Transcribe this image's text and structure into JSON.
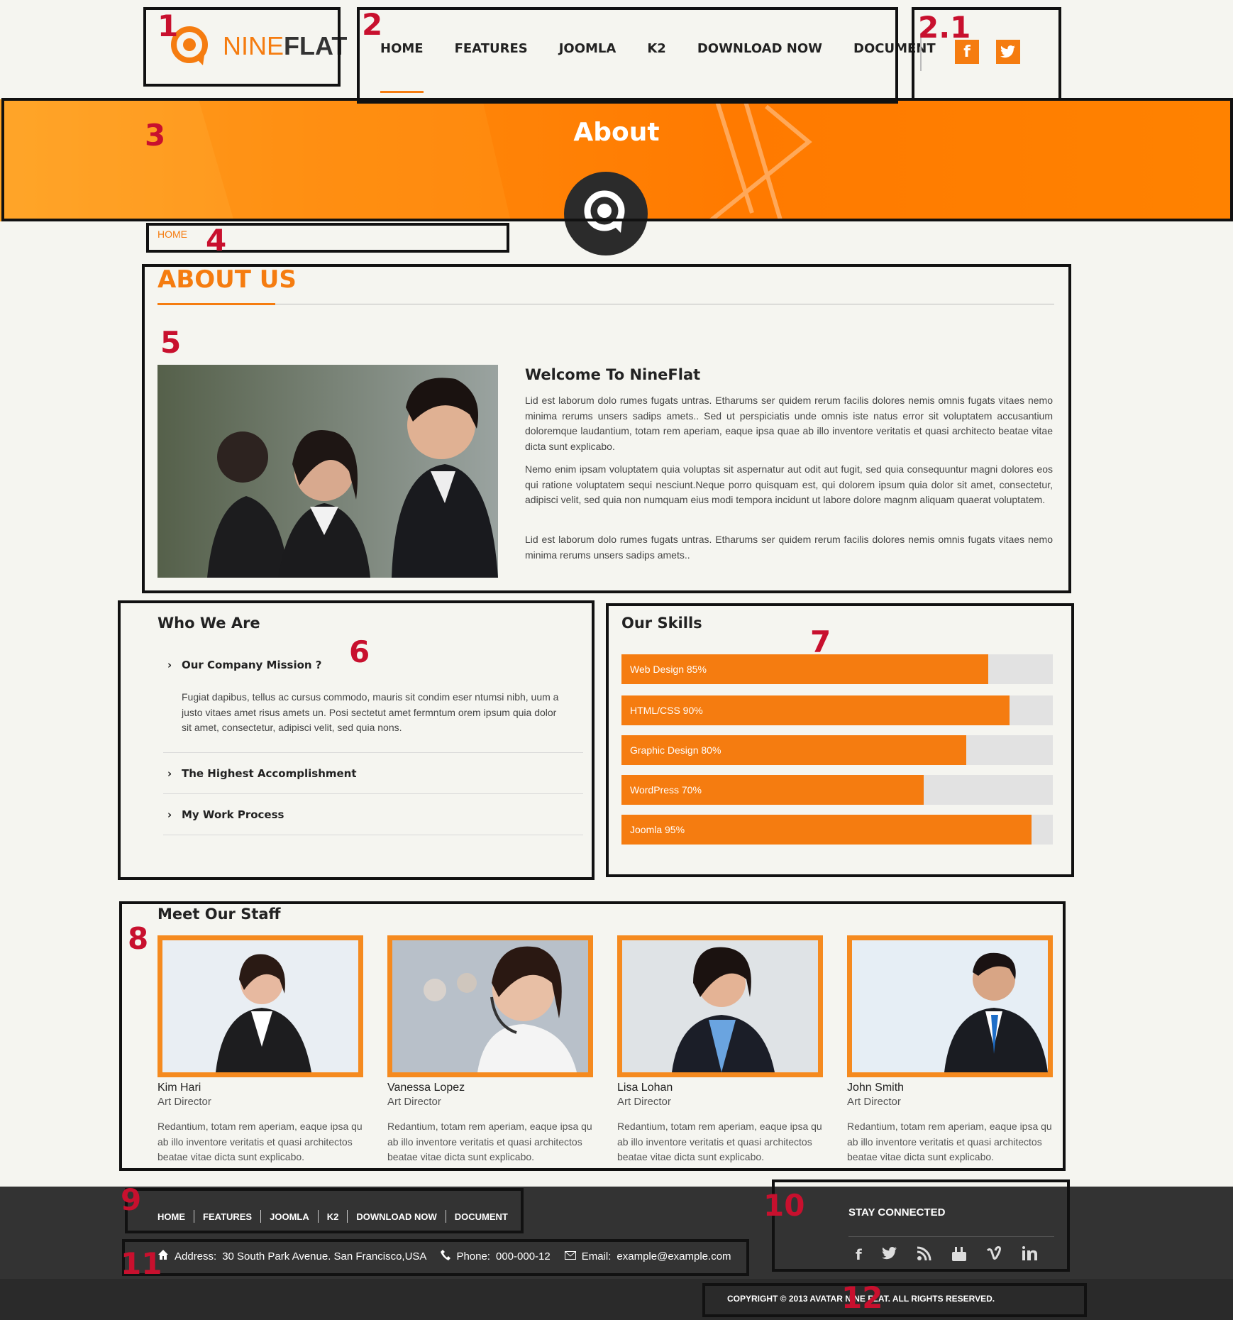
{
  "header": {
    "logo_nine": "NINE",
    "logo_flat": "FLAT",
    "nav": [
      "HOME",
      "FEATURES",
      "JOOMLA",
      "K2",
      "DOWNLOAD NOW",
      "DOCUMENT"
    ],
    "social": [
      "f",
      "t"
    ]
  },
  "annotations": [
    "1",
    "2",
    "2.1",
    "3",
    "4",
    "5",
    "6",
    "7",
    "8",
    "9",
    "10",
    "11",
    "12"
  ],
  "banner": {
    "title": "About"
  },
  "breadcrumb": "HOME",
  "about": {
    "heading": "ABOUT US",
    "welcome": "Welcome To NineFlat",
    "p1": "Lid est laborum dolo rumes fugats untras. Etharums ser quidem rerum facilis dolores nemis omnis fugats vitaes nemo minima rerums unsers sadips amets.. Sed ut perspiciatis unde omnis iste natus error sit voluptatem accusantium doloremque laudantium, totam rem aperiam, eaque ipsa quae ab illo inventore veritatis et quasi architecto beatae vitae dicta sunt explicabo.",
    "p2": "Nemo enim ipsam voluptatem quia voluptas sit aspernatur aut odit aut fugit, sed quia consequuntur magni dolores eos qui ratione voluptatem sequi nesciunt.Neque porro quisquam est, qui dolorem ipsum quia dolor sit amet, consectetur, adipisci velit, sed quia non numquam eius modi tempora incidunt ut labore dolore magnm aliquam quaerat voluptatem.",
    "p3": "Lid est laborum dolo rumes fugats untras. Etharums ser quidem rerum facilis dolores nemis omnis fugats vitaes nemo minima rerums unsers sadips amets.."
  },
  "who": {
    "heading": "Who We Are",
    "items": [
      {
        "title": "Our Company Mission ?",
        "text": "Fugiat dapibus, tellus ac cursus commodo, mauris sit condim eser ntumsi nibh, uum a justo vitaes amet risus amets un. Posi sectetut amet fermntum orem ipsum quia dolor sit amet, consectetur, adipisci velit, sed quia nons."
      },
      {
        "title": "The Highest Accomplishment"
      },
      {
        "title": "My Work Process"
      }
    ]
  },
  "skills": {
    "heading": "Our Skills",
    "items": [
      {
        "label": "Web Design 85%",
        "value": 85
      },
      {
        "label": "HTML/CSS 90%",
        "value": 90
      },
      {
        "label": "Graphic Design 80%",
        "value": 80
      },
      {
        "label": "WordPress 70%",
        "value": 70
      },
      {
        "label": "Joomla 95%",
        "value": 95
      }
    ]
  },
  "staff": {
    "heading": "Meet Our Staff",
    "members": [
      {
        "name": "Kim Hari",
        "role": "Art Director",
        "desc": "Redantium, totam rem aperiam, eaque ipsa qu ab illo inventore veritatis et quasi architectos beatae vitae dicta sunt explicabo."
      },
      {
        "name": "Vanessa Lopez",
        "role": "Art Director",
        "desc": "Redantium, totam rem aperiam, eaque ipsa qu ab illo inventore veritatis et quasi architectos beatae vitae dicta sunt explicabo."
      },
      {
        "name": "Lisa Lohan",
        "role": "Art Director",
        "desc": "Redantium, totam rem aperiam, eaque ipsa qu ab illo inventore veritatis et quasi architectos beatae vitae dicta sunt explicabo."
      },
      {
        "name": "John Smith",
        "role": "Art Director",
        "desc": "Redantium, totam rem aperiam, eaque ipsa qu ab illo inventore veritatis et quasi architectos beatae vitae dicta sunt explicabo."
      }
    ]
  },
  "footer": {
    "nav": [
      "HOME",
      "FEATURES",
      "JOOMLA",
      "K2",
      "DOWNLOAD NOW",
      "DOCUMENT"
    ],
    "stay_connected": "STAY CONNECTED",
    "social": [
      "f",
      "t",
      "rss",
      "yt",
      "v",
      "in"
    ],
    "address_label": "Address:",
    "address": "30 South Park Avenue. San Francisco,USA",
    "phone_label": "Phone:",
    "phone": "000-000-12",
    "email_label": "Email:",
    "email": "example@example.com",
    "copyright": "COPYRIGHT © 2013 AVATAR NINE FLAT. ALL RIGHTS RESERVED."
  },
  "colors": {
    "accent": "#f57c10",
    "footer": "#333333",
    "annotation": "#c8102e"
  }
}
